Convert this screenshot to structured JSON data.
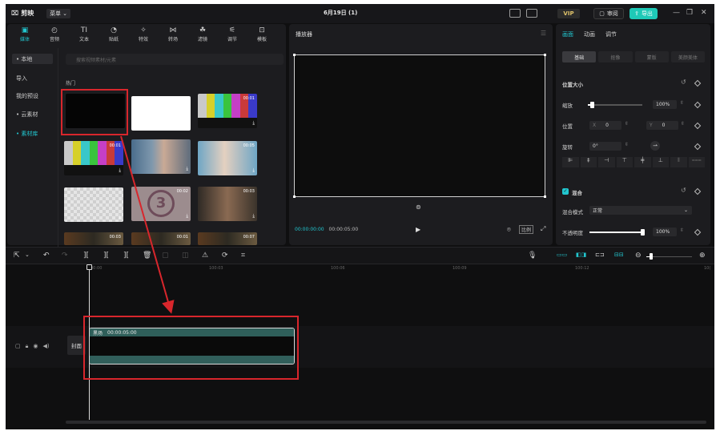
{
  "app": {
    "logo": "剪映",
    "menu_label": "菜单",
    "title": "6月19日 (1)",
    "vip_label": "VIP",
    "review_label": "审阅",
    "export_label": "导出"
  },
  "media_tabs": [
    {
      "label": "媒体",
      "icon": "media-icon",
      "glyph": "▣",
      "active": true
    },
    {
      "label": "音频",
      "icon": "audio-icon",
      "glyph": "◴"
    },
    {
      "label": "文本",
      "icon": "text-icon",
      "glyph": "TI"
    },
    {
      "label": "贴纸",
      "icon": "sticker-icon",
      "glyph": "◔"
    },
    {
      "label": "特效",
      "icon": "effects-icon",
      "glyph": "✧"
    },
    {
      "label": "转场",
      "icon": "transition-icon",
      "glyph": "⋈"
    },
    {
      "label": "滤镜",
      "icon": "filter-icon",
      "glyph": "☘"
    },
    {
      "label": "调节",
      "icon": "adjust-icon",
      "glyph": "⚟"
    },
    {
      "label": "模板",
      "icon": "template-icon",
      "glyph": "⊡"
    }
  ],
  "sidebar": {
    "items": [
      {
        "label": "• 本地",
        "active": true
      },
      {
        "label": "导入"
      },
      {
        "label": "我的预设"
      },
      {
        "label": "• 云素材"
      },
      {
        "label": "• 素材库",
        "accent": true
      }
    ]
  },
  "library": {
    "search_placeholder": "搜索视频素材/元素",
    "section_title": "热门",
    "thumbs": [
      {
        "kind": "black",
        "duration": ""
      },
      {
        "kind": "white",
        "duration": ""
      },
      {
        "kind": "colorbars",
        "duration": "00:01"
      },
      {
        "kind": "colorbars",
        "duration": "00:01"
      },
      {
        "kind": "man-video",
        "duration": ""
      },
      {
        "kind": "waving-video",
        "duration": "00:05"
      },
      {
        "kind": "transparent",
        "duration": ""
      },
      {
        "kind": "countdown",
        "duration": "00:02"
      },
      {
        "kind": "laughing-video",
        "duration": "00:03"
      },
      {
        "kind": "clip-row",
        "duration": "00:03"
      },
      {
        "kind": "clip-row",
        "duration": "00:01"
      },
      {
        "kind": "clip-row",
        "duration": "00:07"
      }
    ]
  },
  "player": {
    "title": "播放器",
    "current_time": "00:00:00:00",
    "total_time": "00:00:05:00",
    "ratio_label": "比例"
  },
  "inspector": {
    "tabs": [
      "画面",
      "动画",
      "调节"
    ],
    "segments": [
      "基础",
      "抠像",
      "蒙版",
      "美颜美体"
    ],
    "position_size_label": "位置大小",
    "scale_label": "缩放",
    "scale_value": "100%",
    "scale_level": 0.08,
    "position_label": "位置",
    "x_label": "X",
    "x_value": "0",
    "y_label": "Y",
    "y_value": "0",
    "rotate_label": "旋转",
    "rotate_value": "0°",
    "blend_label": "混合",
    "blend_mode_label": "混合模式",
    "blend_mode_value": "正常",
    "opacity_label": "不透明度",
    "opacity_value": "100%",
    "opacity_level": 1.0
  },
  "timeline": {
    "ruler_labels": [
      "00:00",
      "100:03",
      "100:06",
      "100:09",
      "100:12",
      "10("
    ],
    "cover_label": "封面",
    "clip_name": "黑场",
    "clip_duration": "00:00:05:00"
  }
}
